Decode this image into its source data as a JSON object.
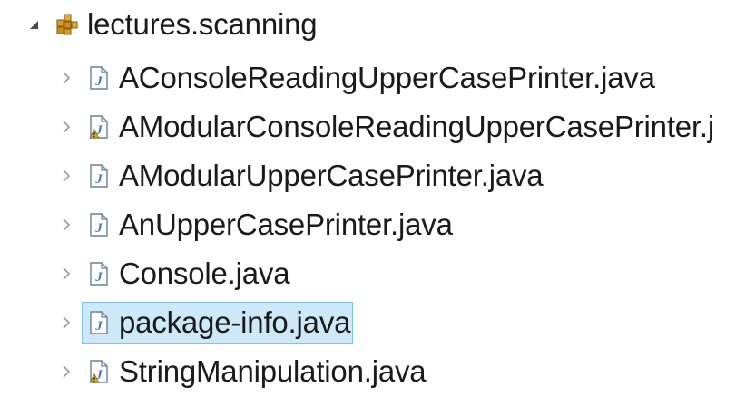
{
  "package": {
    "label": "lectures.scanning",
    "icon": "package-icon",
    "expanded": true
  },
  "files": [
    {
      "label": "AConsoleReadingUpperCasePrinter.java",
      "icon": "java-file-icon",
      "warning": false,
      "selected": false
    },
    {
      "label": "AModularConsoleReadingUpperCasePrinter.j",
      "icon": "java-file-warning-icon",
      "warning": true,
      "selected": false
    },
    {
      "label": "AModularUpperCasePrinter.java",
      "icon": "java-file-icon",
      "warning": false,
      "selected": false
    },
    {
      "label": "AnUpperCasePrinter.java",
      "icon": "java-file-icon",
      "warning": false,
      "selected": false
    },
    {
      "label": "Console.java",
      "icon": "java-file-icon",
      "warning": false,
      "selected": false
    },
    {
      "label": "package-info.java",
      "icon": "java-file-icon",
      "warning": false,
      "selected": true
    },
    {
      "label": "StringManipulation.java",
      "icon": "java-file-warning-icon",
      "warning": true,
      "selected": false
    }
  ],
  "colors": {
    "selection_bg": "#cde8f6",
    "selection_border": "#7fc3e6",
    "twisty": "#9a9a9a",
    "package_icon": "#c8901a",
    "file_icon": "#4a78b5",
    "warning": "#e0b020"
  }
}
